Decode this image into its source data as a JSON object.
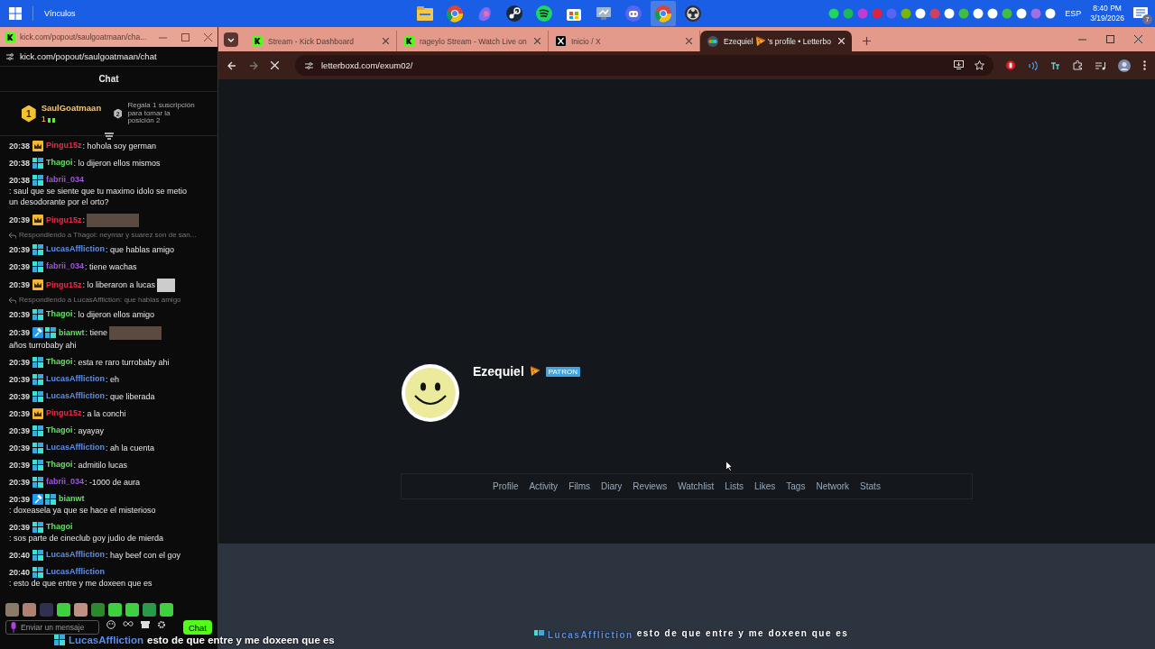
{
  "taskbar": {
    "links_label": "Vínculos",
    "apps": [
      {
        "kind": "folder",
        "selected": false
      },
      {
        "kind": "browser",
        "selected": false
      },
      {
        "kind": "sparkle",
        "selected": false
      },
      {
        "kind": "steam",
        "selected": false
      },
      {
        "kind": "music",
        "selected": false
      },
      {
        "kind": "store",
        "selected": false
      },
      {
        "kind": "network",
        "selected": false
      },
      {
        "kind": "chat",
        "selected": false
      },
      {
        "kind": "browser",
        "selected": true
      },
      {
        "kind": "record",
        "selected": false
      }
    ],
    "language": "ESP",
    "time": "8:40 PM",
    "date": "3/19/2026",
    "notifications": "7"
  },
  "chat_window": {
    "title": "kick.com/popout/saulgoatmaan/cha...",
    "url": "kick.com/popout/saulgoatmaan/chat",
    "header": "Chat",
    "leaderboard": {
      "rank_1": "1",
      "top_user": "SaulGoatmaan",
      "top_count": "1",
      "rank_2": "2",
      "prompt": "Regala 1 suscripción para tomar la posición 2"
    },
    "messages": [
      {
        "kind": "message",
        "time": "20:38",
        "user": "Pingu15z",
        "color": "#e0304a",
        "vip": true,
        "text": ": hohola soy german"
      },
      {
        "kind": "message",
        "time": "20:38",
        "user": "Thagoi",
        "color": "#5ce65c",
        "subscriber": true,
        "text": ": lo dijeron ellos mismos"
      },
      {
        "kind": "message",
        "time": "20:38",
        "user": "fabrii_034",
        "color": "#a352e6",
        "subscriber": true,
        "text": ": saul que se siente que tu maximo idolo se metio un desodorante por el orto?"
      },
      {
        "kind": "message",
        "time": "20:39",
        "user": "Pingu15z",
        "color": "#e0304a",
        "vip": true,
        "text": ":",
        "photo": true
      },
      {
        "kind": "reply",
        "text": "Respondiendo a Thagoi: neymar y suarez son de san..."
      },
      {
        "kind": "message",
        "time": "20:39",
        "user": "LucasAffliction",
        "color": "#5b8fe6",
        "subscriber": true,
        "text": ": que hablas amigo"
      },
      {
        "kind": "message",
        "time": "20:39",
        "user": "fabrii_034",
        "color": "#a352e6",
        "subscriber": true,
        "text": ": tiene wachas"
      },
      {
        "kind": "message",
        "time": "20:39",
        "user": "Pingu15z",
        "color": "#e0304a",
        "vip": true,
        "text": ": lo liberaron a lucas",
        "photo": true
      },
      {
        "kind": "reply",
        "text": "Respondiendo a LucasAffliction: que hablas amigo"
      },
      {
        "kind": "message",
        "time": "20:39",
        "user": "Thagoi",
        "color": "#5ce65c",
        "subscriber": true,
        "text": ": lo dijeron ellos amigo"
      },
      {
        "kind": "message",
        "time": "20:39",
        "user": "bianwt",
        "color": "#5ce65c",
        "moderator": true,
        "subscriber": true,
        "text": ": tiene",
        "photo": true,
        "text_after": "años turrobaby ahi"
      },
      {
        "kind": "message",
        "time": "20:39",
        "user": "Thagoi",
        "color": "#5ce65c",
        "subscriber": true,
        "text": ": esta re raro turrobaby ahi"
      },
      {
        "kind": "message",
        "time": "20:39",
        "user": "LucasAffliction",
        "color": "#5b8fe6",
        "subscriber": true,
        "text": ": eh"
      },
      {
        "kind": "message",
        "time": "20:39",
        "user": "LucasAffliction",
        "color": "#5b8fe6",
        "subscriber": true,
        "text": ": que liberada"
      },
      {
        "kind": "message",
        "time": "20:39",
        "user": "Pingu15z",
        "color": "#e0304a",
        "vip": true,
        "text": ": a la conchi"
      },
      {
        "kind": "message",
        "time": "20:39",
        "user": "Thagoi",
        "color": "#5ce65c",
        "subscriber": true,
        "text": ": ayayay"
      },
      {
        "kind": "message",
        "time": "20:39",
        "user": "LucasAffliction",
        "color": "#5b8fe6",
        "subscriber": true,
        "text": ": ah la cuenta"
      },
      {
        "kind": "message",
        "time": "20:39",
        "user": "Thagoi",
        "color": "#5ce65c",
        "subscriber": true,
        "text": ": admitilo lucas"
      },
      {
        "kind": "message",
        "time": "20:39",
        "user": "fabrii_034",
        "color": "#a352e6",
        "subscriber": true,
        "text": ": -1000 de aura"
      },
      {
        "kind": "message",
        "time": "20:39",
        "user": "bianwt",
        "color": "#5ce65c",
        "moderator": true,
        "subscriber": true,
        "text": ": doxeasela ya que se hace el misterioso"
      },
      {
        "kind": "message",
        "time": "20:39",
        "user": "Thagoi",
        "color": "#5ce65c",
        "subscriber": true,
        "text": ": sos parte de cineclub goy judio de mierda"
      },
      {
        "kind": "message",
        "time": "20:40",
        "user": "LucasAffliction",
        "color": "#5b8fe6",
        "subscriber": true,
        "text": ": hay beef con el goy"
      },
      {
        "kind": "message",
        "time": "20:40",
        "user": "LucasAffliction",
        "color": "#5b8fe6",
        "subscriber": true,
        "text": ": esto de que entre y me doxeen que es"
      }
    ],
    "input": {
      "placeholder": "Enviar un mensaje"
    },
    "send_button": "Chat"
  },
  "browser": {
    "tabs": [
      {
        "kind": "kick",
        "title": "Stream - Kick Dashboard",
        "selected": false
      },
      {
        "kind": "kick",
        "title": "rageylo Stream - Watch Live on",
        "selected": false
      },
      {
        "kind": "x",
        "title": "Inicio / X",
        "selected": false
      },
      {
        "kind": "letterboxd",
        "title": "Ezequiel",
        "title_end": "'s profile • Letterbo",
        "selected": true
      }
    ],
    "url": "letterboxd.com/exum02/",
    "profile": {
      "name": "Ezequiel",
      "badge": "PATRON",
      "nav": [
        "Profile",
        "Activity",
        "Films",
        "Diary",
        "Reviews",
        "Watchlist",
        "Lists",
        "Likes",
        "Tags",
        "Network",
        "Stats"
      ]
    }
  },
  "stream_overlay": [
    {
      "user": "LucasAffliction",
      "text": "esto de que entre y me doxeen que es"
    },
    {
      "user": "LucasAffliction",
      "text": "esto de que entre y me doxeen que es"
    }
  ]
}
